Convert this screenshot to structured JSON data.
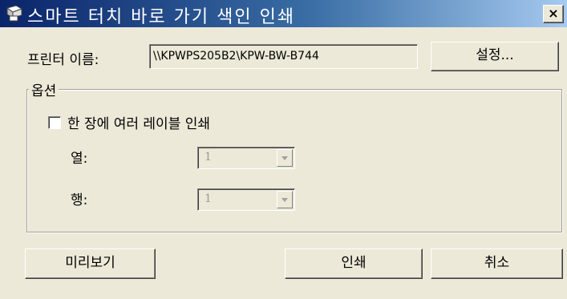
{
  "window": {
    "title": "스마트 터치 바로 가기 색인 인쇄",
    "close_label": "×",
    "title_icon": "printer-icon",
    "close_icon": "close-icon"
  },
  "printer": {
    "label": "프린터 이름:",
    "value": "\\\\KPWPS205B2\\KPW-BW-B744",
    "settings_button": "설정..."
  },
  "options": {
    "group_label": "옵션",
    "multi_label_checkbox": {
      "label": "한 장에 여러 레이블 인쇄",
      "checked": false
    },
    "columns": {
      "label": "열:",
      "value": "1"
    },
    "rows": {
      "label": "행:",
      "value": "1"
    }
  },
  "footer": {
    "preview_button": "미리보기",
    "print_button": "인쇄",
    "cancel_button": "취소"
  },
  "colors": {
    "title_gradient_start": "#0a246a",
    "title_gradient_end": "#a6caf0",
    "face": "#ece9d8"
  }
}
